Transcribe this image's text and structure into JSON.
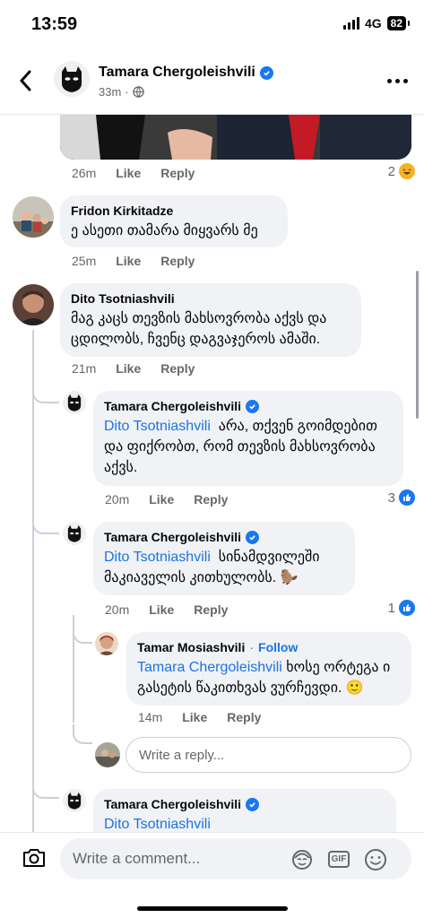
{
  "status": {
    "time": "13:59",
    "network": "4G",
    "battery": "82"
  },
  "header": {
    "name": "Tamara Chergoleishvili",
    "time": "33m"
  },
  "prev": {
    "time": "26m",
    "like": "Like",
    "reply": "Reply",
    "reactions": "2"
  },
  "comments": [
    {
      "name": "Fridon Kirkitadze",
      "text": "ე ასეთი თამარა მიყვარს მე",
      "time": "25m",
      "like": "Like",
      "reply": "Reply"
    },
    {
      "name": "Dito Tsotniashvili",
      "text": "მაგ კაცს თევზის მახსოვრობა აქვს და ცდილობს, ჩვენც დაგვაჯეროს ამაში.",
      "time": "21m",
      "like": "Like",
      "reply": "Reply"
    }
  ],
  "replies": [
    {
      "name": "Tamara Chergoleishvili",
      "mention": "Dito Tsotniashvili",
      "text": "არა, თქვენ გოიმდებით და ფიქრობთ, რომ თევზის მახსოვრობა აქვს.",
      "time": "20m",
      "like": "Like",
      "reply": "Reply",
      "reactions": "3"
    },
    {
      "name": "Tamara Chergoleishvili",
      "mention": "Dito Tsotniashvili",
      "text": "სინამდვილეში მაკიაველის კითხულობს. 🦫",
      "time": "20m",
      "like": "Like",
      "reply": "Reply",
      "reactions": "1"
    },
    {
      "name": "Tamar Mosiashvili",
      "follow": "Follow",
      "mention": "Tamara Chergoleishvili",
      "text": "ხოსე ორტეგა ი გასეტის წაკითხვას ვურჩევდი. 🙂",
      "time": "14m",
      "like": "Like",
      "reply": "Reply"
    },
    {
      "name": "Tamara Chergoleishvili",
      "mention": "Dito Tsotniashvili"
    }
  ],
  "reply_input": {
    "placeholder": "Write a reply..."
  },
  "comment_input": {
    "placeholder": "Write a comment...",
    "gif": "GIF"
  }
}
